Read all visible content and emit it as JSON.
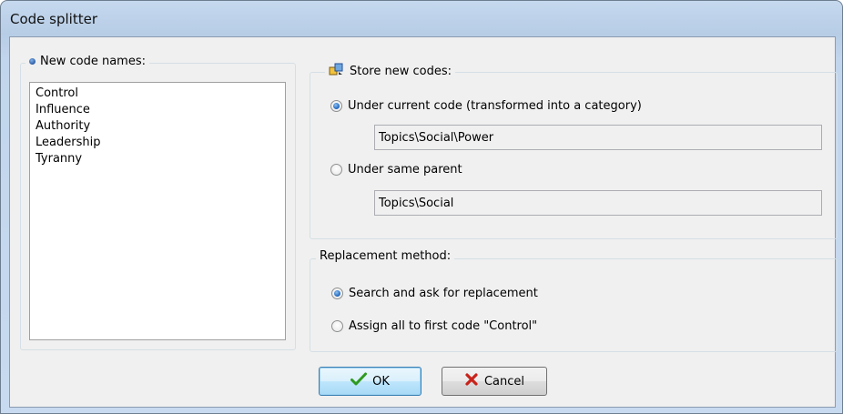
{
  "window": {
    "title": "Code splitter"
  },
  "new_codes": {
    "label": "New code names:",
    "items": [
      "Control",
      "Influence",
      "Authority",
      "Leadership",
      "Tyranny"
    ]
  },
  "store": {
    "label": "Store new codes:",
    "option_current": "Under current code (transformed into a category)",
    "option_current_checked": true,
    "current_path": "Topics\\Social\\Power",
    "option_parent": "Under same parent",
    "option_parent_checked": false,
    "parent_path": "Topics\\Social"
  },
  "replacement": {
    "label": "Replacement method:",
    "option_search": "Search and ask for replacement",
    "option_search_checked": true,
    "option_assign": "Assign all to first code \"Control\"",
    "option_assign_checked": false
  },
  "buttons": {
    "ok": "OK",
    "cancel": "Cancel"
  },
  "colors": {
    "accent": "#2a6fc4",
    "ok_check": "#2e9a1f",
    "cancel_x": "#c8231b"
  },
  "icons": {
    "store": "store-codes-icon",
    "ok": "checkmark-icon",
    "cancel": "x-icon"
  }
}
